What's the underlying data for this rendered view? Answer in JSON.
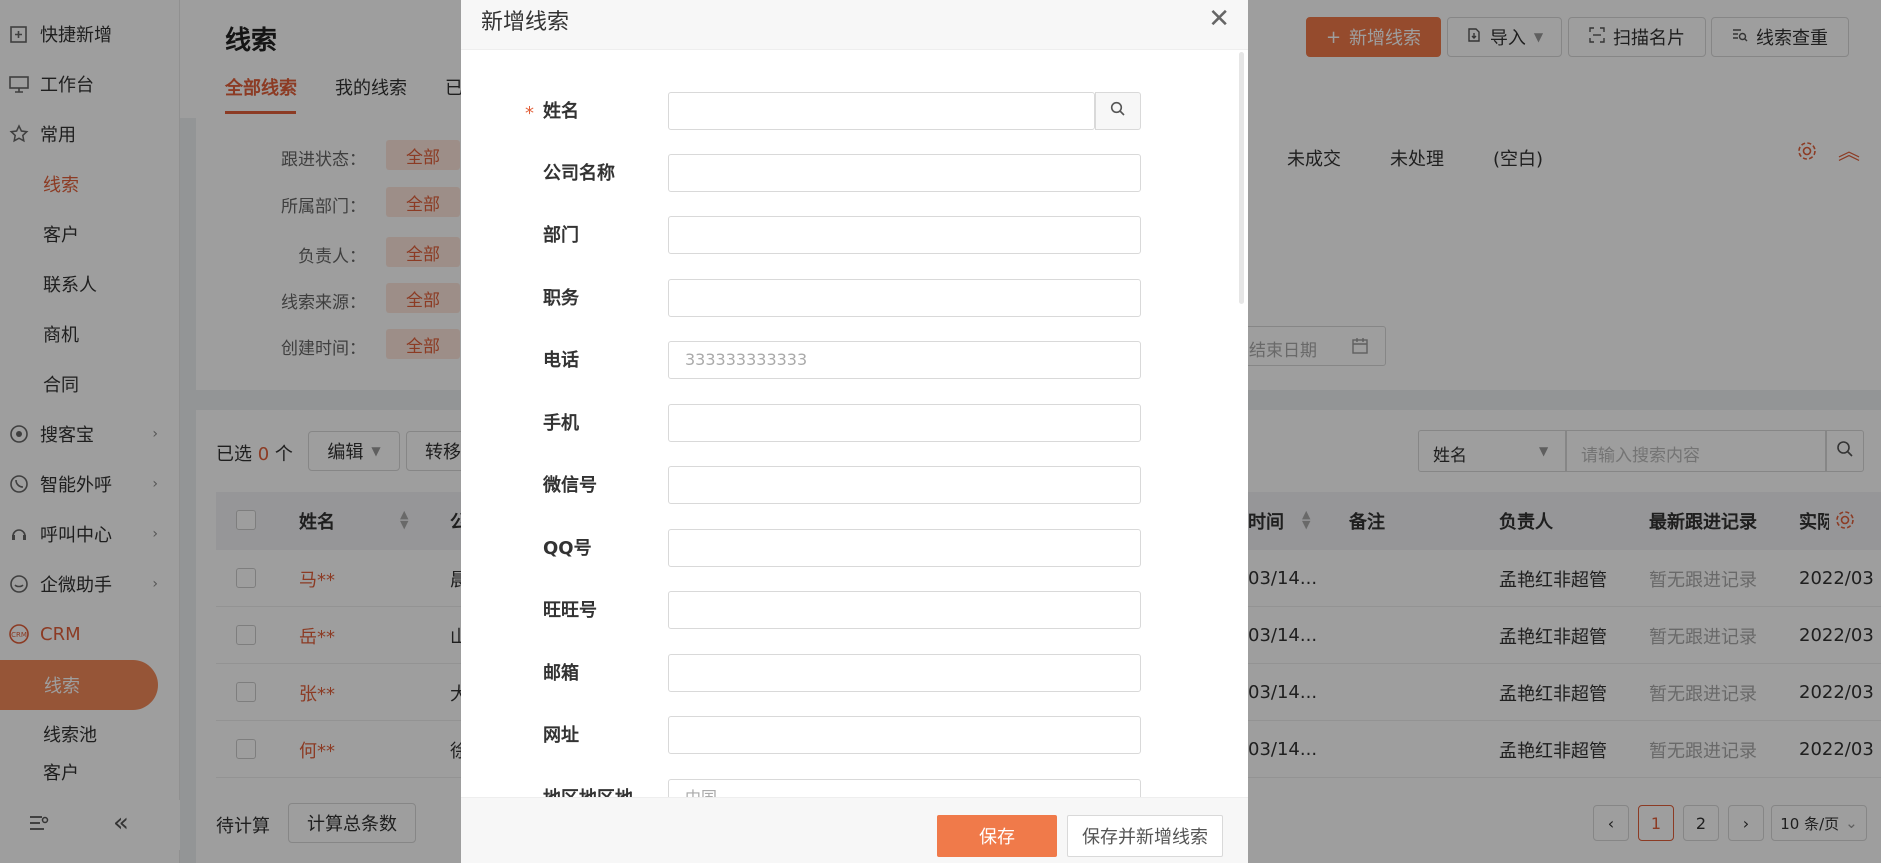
{
  "sidebar": {
    "items": [
      {
        "label": "快捷新增",
        "icon": "plus-square-icon"
      },
      {
        "label": "工作台",
        "icon": "monitor-icon"
      },
      {
        "label": "常用",
        "icon": "star-icon"
      },
      {
        "label": "线索"
      },
      {
        "label": "客户"
      },
      {
        "label": "联系人"
      },
      {
        "label": "商机"
      },
      {
        "label": "合同"
      },
      {
        "label": "搜客宝",
        "icon": "search-circle-icon"
      },
      {
        "label": "智能外呼",
        "icon": "phone-icon"
      },
      {
        "label": "呼叫中心",
        "icon": "headset-icon"
      },
      {
        "label": "企微助手",
        "icon": "wechat-work-icon"
      },
      {
        "label": "CRM",
        "icon": "crm-icon"
      },
      {
        "label": "线索"
      },
      {
        "label": "线索池"
      },
      {
        "label": "客户"
      }
    ]
  },
  "header": {
    "title": "线索",
    "tabs": [
      "全部线索",
      "我的线索",
      "已"
    ],
    "buttons": {
      "add": "新增线索",
      "import": "导入",
      "scan": "扫描名片",
      "dedupe": "线索查重"
    }
  },
  "filters": {
    "labels": [
      "跟进状态：",
      "所属部门：",
      "负责人：",
      "线索来源：",
      "创建时间："
    ],
    "all": "全部",
    "status_options": [
      "未成交",
      "未处理",
      "(空白)"
    ],
    "end_date": "结束日期"
  },
  "toolbar": {
    "selected_prefix": "已选",
    "selected_count": "0",
    "selected_suffix": "个",
    "edit": "编辑",
    "transfer": "转移",
    "search_field": "姓名",
    "search_placeholder": "请输入搜索内容"
  },
  "table": {
    "headers": {
      "name": "姓名",
      "company": "公",
      "time": "时间",
      "remark": "备注",
      "owner": "负责人",
      "latest": "最新跟进记录",
      "actual": "实际"
    },
    "rows": [
      {
        "name": "马**",
        "company": "晨",
        "time": "03/14...",
        "owner": "孟艳红非超管",
        "latest": "暂无跟进记录",
        "actual": "2022/03"
      },
      {
        "name": "岳**",
        "company": "山",
        "time": "03/14...",
        "owner": "孟艳红非超管",
        "latest": "暂无跟进记录",
        "actual": "2022/03"
      },
      {
        "name": "张**",
        "company": "大",
        "time": "03/14...",
        "owner": "孟艳红非超管",
        "latest": "暂无跟进记录",
        "actual": "2022/03"
      },
      {
        "name": "何**",
        "company": "徐",
        "time": "03/14...",
        "owner": "孟艳红非超管",
        "latest": "暂无跟进记录",
        "actual": "2022/03"
      }
    ]
  },
  "footer": {
    "pending": "待计算",
    "calc_total": "计算总条数",
    "pages": [
      "1",
      "2"
    ],
    "page_size": "10 条/页"
  },
  "modal": {
    "title": "新增线索",
    "fields": [
      {
        "label": "姓名",
        "required": true,
        "value": ""
      },
      {
        "label": "公司名称",
        "value": ""
      },
      {
        "label": "部门",
        "value": ""
      },
      {
        "label": "职务",
        "value": ""
      },
      {
        "label": "电话",
        "value": "333333333333"
      },
      {
        "label": "手机",
        "value": ""
      },
      {
        "label": "微信号",
        "value": ""
      },
      {
        "label": "QQ号",
        "value": ""
      },
      {
        "label": "旺旺号",
        "value": ""
      },
      {
        "label": "邮箱",
        "value": ""
      },
      {
        "label": "网址",
        "value": ""
      },
      {
        "label": "地区地区地",
        "value": "中国"
      }
    ],
    "save": "保存",
    "save_and_new": "保存并新增线索"
  },
  "colors": {
    "accent": "#f07a4a",
    "accent_text": "#e2603a"
  }
}
